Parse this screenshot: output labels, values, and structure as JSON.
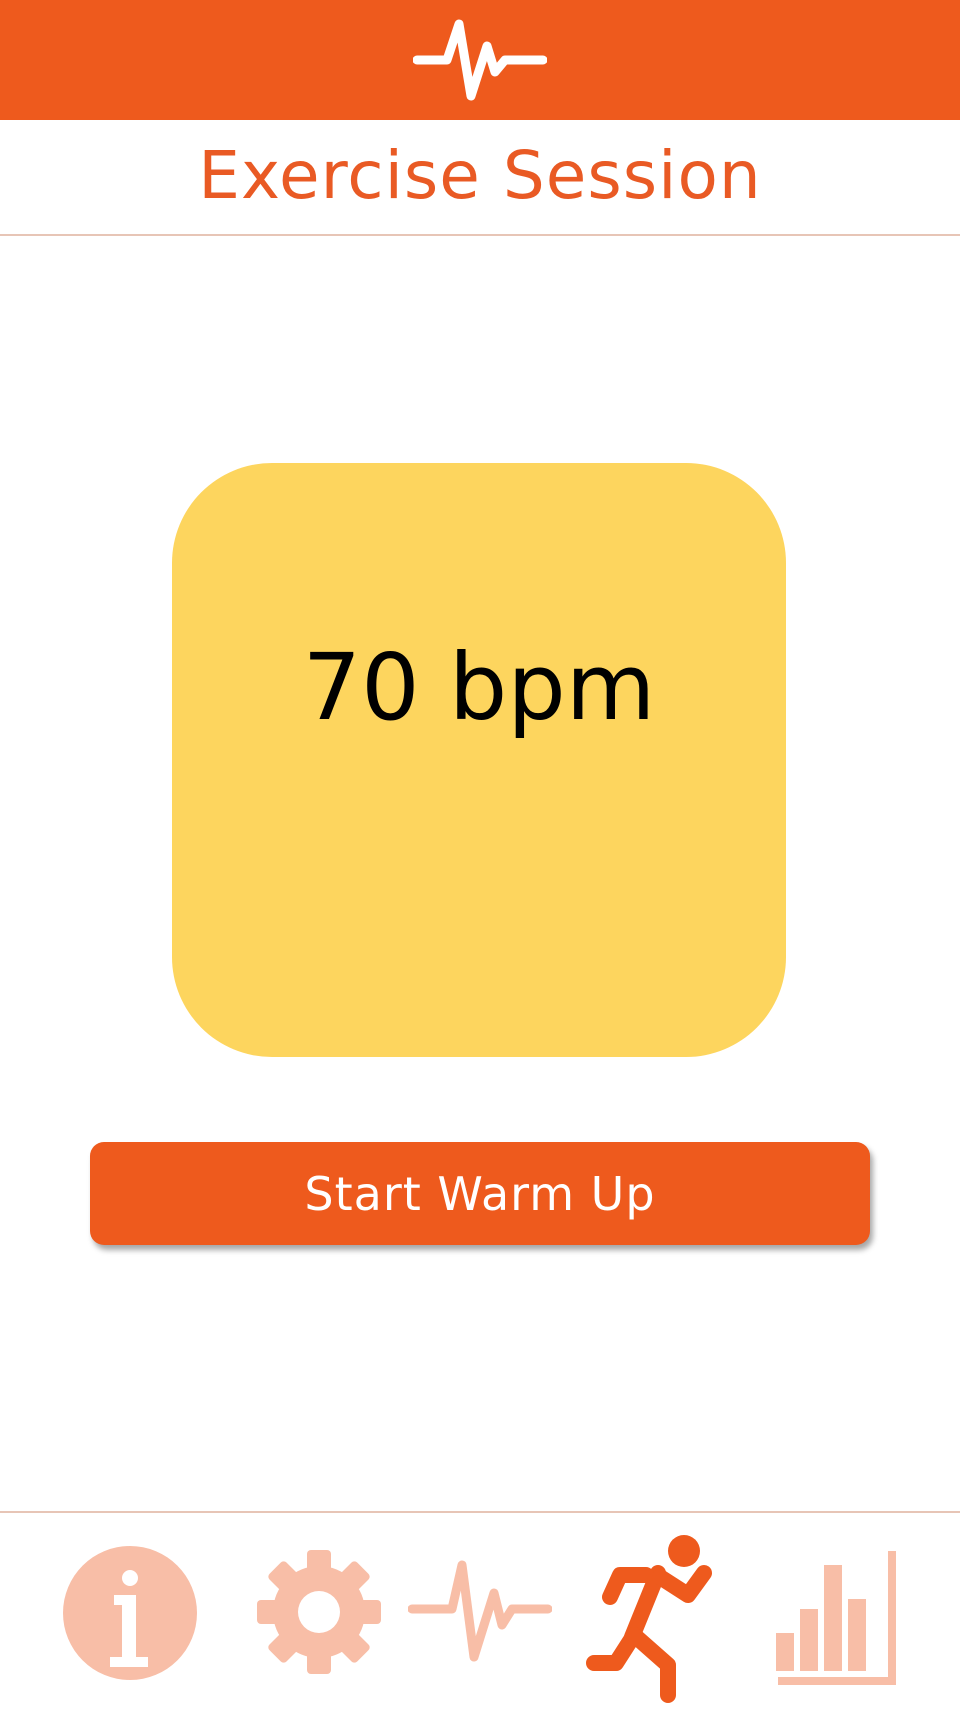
{
  "header": {
    "logo_icon": "heartbeat-icon",
    "title": "Exercise Session"
  },
  "heart_rate": {
    "display": "70 bpm",
    "value": 70,
    "unit": "bpm",
    "tile_color": "#fdd55e"
  },
  "actions": {
    "start_label": "Start Warm Up"
  },
  "bottom_nav": {
    "items": [
      {
        "id": "info",
        "icon": "info-icon",
        "active": false
      },
      {
        "id": "settings",
        "icon": "gear-icon",
        "active": false
      },
      {
        "id": "monitor",
        "icon": "heartbeat-icon",
        "active": false
      },
      {
        "id": "exercise",
        "icon": "running-person-icon",
        "active": true
      },
      {
        "id": "stats",
        "icon": "bar-chart-icon",
        "active": false
      }
    ]
  },
  "colors": {
    "accent": "#ee5a1d",
    "accent_inactive": "#f8bea7",
    "divider": "#e7c5b6",
    "background": "#ffffff"
  }
}
